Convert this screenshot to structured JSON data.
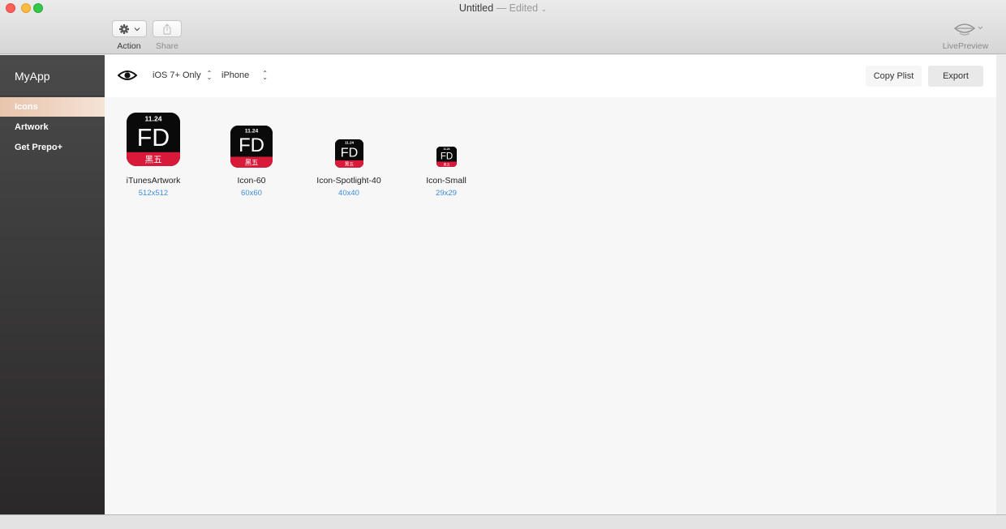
{
  "window": {
    "title": "Untitled",
    "edited": "— Edited",
    "chevron": "⌄"
  },
  "toolbar": {
    "action_label": "Action",
    "share_label": "Share",
    "live_preview_label": "LivePreview",
    "action_icon": "gear-icon",
    "share_icon": "share-icon",
    "live_icon": "eye-preview-icon"
  },
  "sidebar": {
    "app_name": "MyApp",
    "items": [
      {
        "label": "Icons",
        "active": true
      },
      {
        "label": "Artwork",
        "active": false
      },
      {
        "label": "Get Prepo+",
        "active": false
      }
    ]
  },
  "filters": {
    "ios_version": "iOS 7+ Only",
    "device": "iPhone"
  },
  "buttons": {
    "copy_plist": "Copy Plist",
    "export": "Export"
  },
  "icons": [
    {
      "name": "iTunesArtwork",
      "size": "512x512"
    },
    {
      "name": "Icon-60",
      "size": "60x60"
    },
    {
      "name": "Icon-Spotlight-40",
      "size": "40x40"
    },
    {
      "name": "Icon-Small",
      "size": "29x29"
    }
  ],
  "icon_art": {
    "date": "11.24",
    "letters": "FD",
    "banner": "黑五"
  },
  "colors": {
    "accent": "#3d8ede",
    "active_item": "#e8c4ac",
    "icon_banner": "#d8193a"
  }
}
